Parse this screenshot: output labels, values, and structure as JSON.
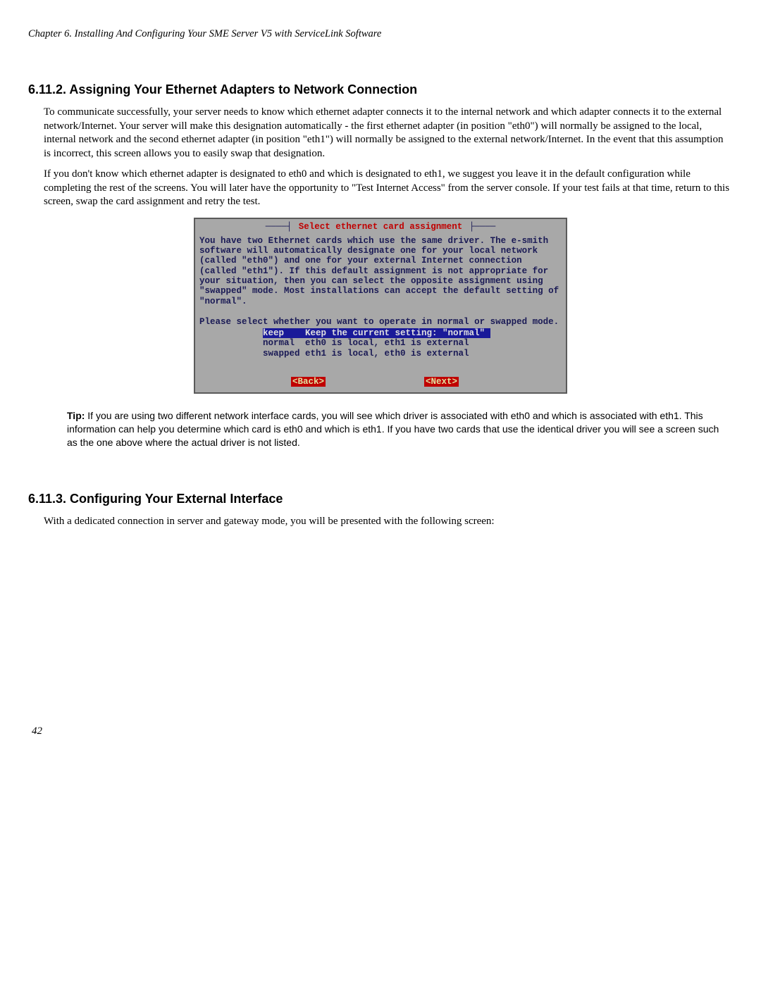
{
  "header": {
    "chapter_line": "Chapter 6. Installing And Configuring Your SME Server V5 with ServiceLink Software"
  },
  "section1": {
    "heading": "6.11.2. Assigning Your Ethernet Adapters to Network Connection",
    "para1": "To communicate successfully, your server needs to know which ethernet adapter connects it to the internal network and which adapter connects it to the external network/Internet. Your server will make this designation automatically - the first ethernet adapter (in position \"eth0\") will normally be assigned to the local, internal network and the second ethernet adapter (in position \"eth1\") will normally be assigned to the external network/Internet. In the event that this assumption is incorrect, this screen allows you to easily swap that designation.",
    "para2": "If you don't know which ethernet adapter is designated to eth0 and which is designated to eth1, we suggest you leave it in the default configuration while completing the rest of the screens. You will later have the opportunity to \"Test Internet Access\" from the server console. If your test fails at that time, return to this screen, swap the card assignment and retry the test."
  },
  "terminal": {
    "title": " Select ethernet card assignment ",
    "message": "You have two Ethernet cards which use the same driver. The e-smith\nsoftware will automatically designate one for your local network\n(called \"eth0\") and one for your external Internet connection\n(called \"eth1\"). If this default assignment is not appropriate for\nyour situation, then you can select the opposite assignment using\n\"swapped\" mode. Most installations can accept the default setting of\n\"normal\".\n\nPlease select whether you want to operate in normal or swapped mode.",
    "options": [
      {
        "key": "keep   ",
        "desc": " Keep the current setting: \"normal\" ",
        "selected": true
      },
      {
        "key": "normal ",
        "desc": " eth0 is local, eth1 is external",
        "selected": false
      },
      {
        "key": "swapped",
        "desc": " eth1 is local, eth0 is external",
        "selected": false
      }
    ],
    "back_label": "<Back>",
    "next_label": "<Next>"
  },
  "tip": {
    "label": "Tip:",
    "text": " If you are using two different network interface cards, you will see which driver is associated with eth0 and which is associated with eth1. This information can help you determine which card is eth0 and which is eth1. If you have two cards that use the identical driver you will see a screen such as the one above where the actual driver is not listed."
  },
  "section2": {
    "heading": "6.11.3. Configuring Your External Interface",
    "para1": "With a dedicated connection in server and gateway mode, you will be presented with the following screen:"
  },
  "page_number": "42"
}
